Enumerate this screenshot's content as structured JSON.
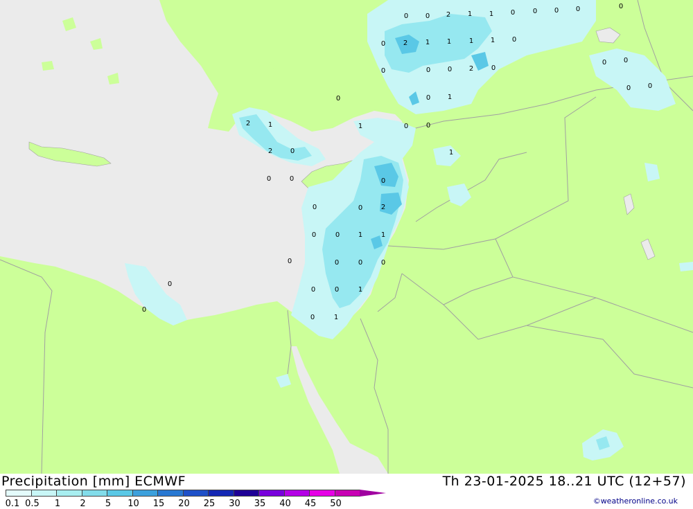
{
  "title": "Precipitation [mm] ECMWF",
  "datetime": "Th 23-01-2025 18..21 UTC (12+57)",
  "credit": "©weatheronline.co.uk",
  "colors": {
    "land": "#ccff99",
    "sea": "#ebebeb",
    "precip_light": "#c8f6f6",
    "precip_mid": "#96e8f0",
    "precip_heavy": "#5ac8e6",
    "border": "#a0a0a0"
  },
  "legend": {
    "labels": [
      "0.1",
      "0.5",
      "1",
      "2",
      "5",
      "10",
      "15",
      "20",
      "25",
      "30",
      "35",
      "40",
      "45",
      "50"
    ],
    "colors": [
      "#e4fcfc",
      "#c8f6f6",
      "#a8eef0",
      "#82dcea",
      "#5ac8e6",
      "#3ca0dc",
      "#2878d2",
      "#1e50c8",
      "#1428b4",
      "#1e0096",
      "#7800dc",
      "#b400e6",
      "#e600e6",
      "#c800b4",
      "#a000a0"
    ]
  },
  "values": [
    {
      "v": "0"
    },
    {
      "v": "0"
    },
    {
      "v": "2"
    },
    {
      "v": "1"
    },
    {
      "v": "1"
    },
    {
      "v": "0"
    },
    {
      "v": "0"
    },
    {
      "v": "0"
    },
    {
      "v": "0"
    },
    {
      "v": "0"
    },
    {
      "v": "0"
    },
    {
      "v": "2"
    },
    {
      "v": "1"
    },
    {
      "v": "1"
    },
    {
      "v": "1"
    },
    {
      "v": "1"
    },
    {
      "v": "0"
    },
    {
      "v": "0"
    },
    {
      "v": "0"
    },
    {
      "v": "0"
    },
    {
      "v": "2"
    },
    {
      "v": "0"
    },
    {
      "v": "0"
    },
    {
      "v": "0"
    },
    {
      "v": "0"
    },
    {
      "v": "1"
    },
    {
      "v": "0"
    },
    {
      "v": "0"
    },
    {
      "v": "0"
    },
    {
      "v": "2"
    },
    {
      "v": "1"
    },
    {
      "v": "1"
    },
    {
      "v": "0"
    },
    {
      "v": "0"
    },
    {
      "v": "2"
    },
    {
      "v": "0"
    },
    {
      "v": "1"
    },
    {
      "v": "0"
    },
    {
      "v": "0"
    },
    {
      "v": "0"
    },
    {
      "v": "0"
    },
    {
      "v": "0"
    },
    {
      "v": "2"
    },
    {
      "v": "0"
    },
    {
      "v": "0"
    },
    {
      "v": "1"
    },
    {
      "v": "1"
    },
    {
      "v": "0"
    },
    {
      "v": "0"
    },
    {
      "v": "0"
    },
    {
      "v": "0"
    },
    {
      "v": "0"
    },
    {
      "v": "0"
    },
    {
      "v": "0"
    },
    {
      "v": "1"
    },
    {
      "v": "0"
    },
    {
      "v": "0"
    },
    {
      "v": "1"
    }
  ]
}
